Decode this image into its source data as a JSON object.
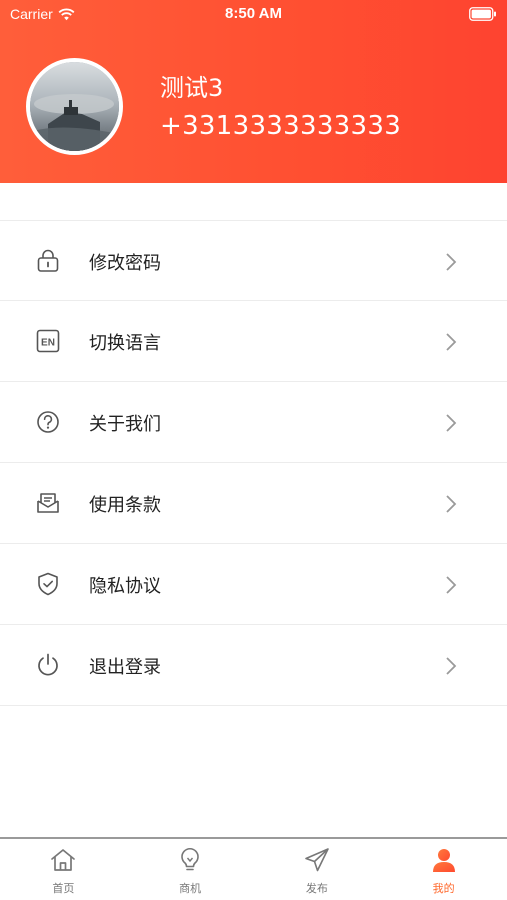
{
  "status_bar": {
    "carrier": "Carrier",
    "time": "8:50 AM"
  },
  "profile": {
    "name": "测试3",
    "phone": "+3313333333333"
  },
  "menu": {
    "items": [
      {
        "label": "修改密码",
        "icon": "lock-icon"
      },
      {
        "label": "切换语言",
        "icon": "en-language-icon"
      },
      {
        "label": "关于我们",
        "icon": "question-circle-icon"
      },
      {
        "label": "使用条款",
        "icon": "mail-envelope-icon"
      },
      {
        "label": "隐私协议",
        "icon": "shield-check-icon"
      },
      {
        "label": "退出登录",
        "icon": "power-icon"
      }
    ]
  },
  "tabbar": {
    "tabs": [
      {
        "label": "首页",
        "icon": "home-icon"
      },
      {
        "label": "商机",
        "icon": "lightbulb-icon"
      },
      {
        "label": "发布",
        "icon": "paper-plane-icon"
      },
      {
        "label": "我的",
        "icon": "user-icon"
      }
    ],
    "active_index": 3
  },
  "colors": {
    "accent": "#ff5a34",
    "active_tab": "#ff6a2e",
    "inactive_tab": "#777777"
  }
}
